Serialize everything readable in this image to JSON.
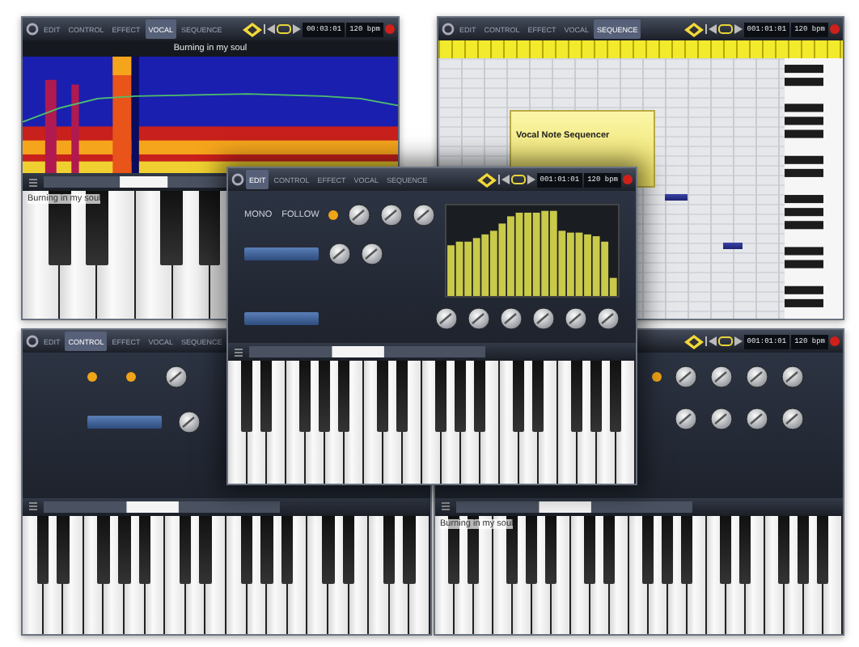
{
  "windows": [
    {
      "kind": "spectrogram",
      "toolbar": {
        "tabs": [
          {
            "label": "EDIT",
            "selected": false
          },
          {
            "label": "CONTROL",
            "selected": false
          },
          {
            "label": "EFFECT",
            "selected": false
          },
          {
            "label": "VOCAL",
            "selected": true
          },
          {
            "label": "SEQUENCE",
            "selected": false
          }
        ],
        "position": "00:03:01",
        "tempo": "120 bpm"
      },
      "title": "Burning in my soul",
      "piano_label": "Burning in my soul"
    },
    {
      "kind": "sequencer",
      "toolbar": {
        "tabs": [
          {
            "label": "EDIT",
            "selected": false
          },
          {
            "label": "CONTROL",
            "selected": false
          },
          {
            "label": "EFFECT",
            "selected": false
          },
          {
            "label": "VOCAL",
            "selected": false
          },
          {
            "label": "SEQUENCE",
            "selected": true
          }
        ],
        "position": "001:01:01",
        "tempo": "120 bpm"
      },
      "note_card": {
        "title": "Vocal Note Sequencer"
      }
    },
    {
      "kind": "control",
      "toolbar": {
        "tabs": [
          {
            "label": "EDIT",
            "selected": false
          },
          {
            "label": "CONTROL",
            "selected": true
          },
          {
            "label": "EFFECT",
            "selected": false
          },
          {
            "label": "VOCAL",
            "selected": false
          },
          {
            "label": "SEQUENCE",
            "selected": false
          }
        ]
      },
      "toggles": [
        {
          "on": true
        },
        {
          "on": true
        }
      ]
    },
    {
      "kind": "effects",
      "toolbar": {
        "position": "001:01:01",
        "tempo": "120 bpm"
      },
      "toggles": [
        {
          "on": true
        }
      ],
      "piano_label": "Burning in my soul"
    },
    {
      "kind": "editor",
      "toolbar": {
        "tabs": [
          {
            "label": "EDIT",
            "selected": true
          },
          {
            "label": "CONTROL",
            "selected": false
          },
          {
            "label": "EFFECT",
            "selected": false
          },
          {
            "label": "VOCAL",
            "selected": false
          },
          {
            "label": "SEQUENCE",
            "selected": false
          }
        ],
        "position": "001:01:01",
        "tempo": "120 bpm"
      },
      "mono_label": "MONO",
      "follow_label": "FOLLOW",
      "toggles": [
        {
          "on": true
        }
      ]
    }
  ]
}
